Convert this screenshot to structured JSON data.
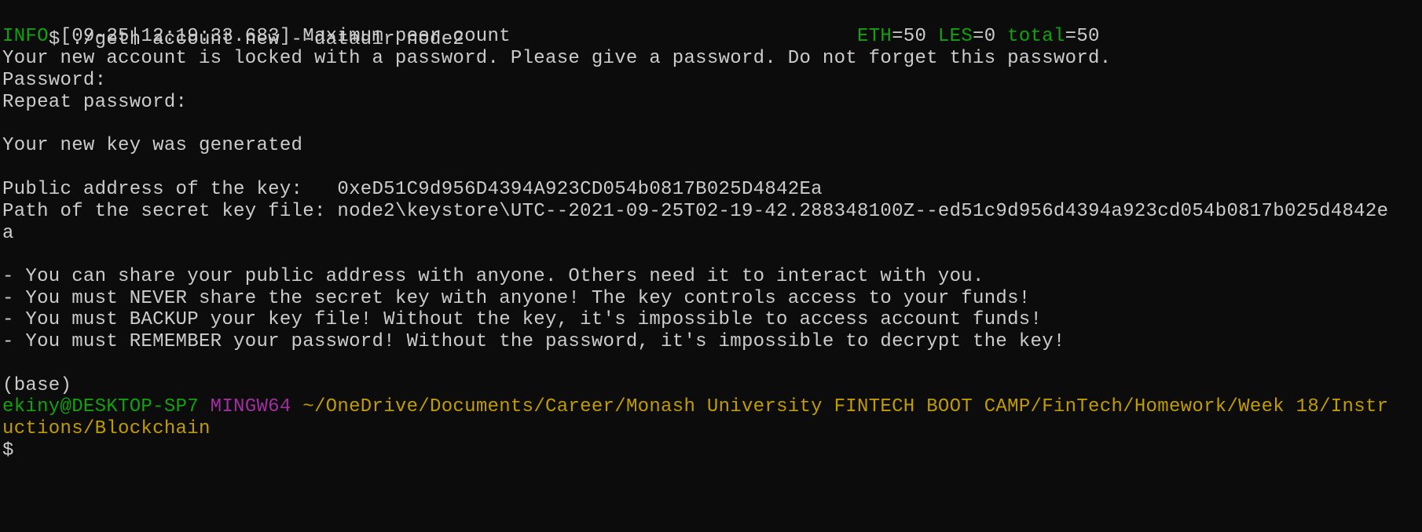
{
  "terminal": {
    "command_line": "$ ./geth account new --datadir node2",
    "info": {
      "level": "INFO",
      "timestamp": "[09-25|12:19:33.683]",
      "message": "Maximum peer count",
      "pad": "                        ",
      "eth_key": "ETH",
      "eth_val": "=50",
      "les_key": "LES",
      "les_val": "=0",
      "total_key": "total",
      "total_val": "=50"
    },
    "locked_msg": "Your new account is locked with a password. Please give a password. Do not forget this password.",
    "password_prompt": "Password:",
    "repeat_prompt": "Repeat password:",
    "generated_msg": "Your new key was generated",
    "public_address_label": "Public address of the key:   ",
    "public_address": "0xeD51C9d956D4394A923CD054b0817B025D4842Ea",
    "secret_path_label": "Path of the secret key file: ",
    "secret_path": "node2\\keystore\\UTC--2021-09-25T02-19-42.288348100Z--ed51c9d956d4394a923cd054b0817b025d4842e",
    "secret_path_wrap": "a",
    "warnings": [
      "- You can share your public address with anyone. Others need it to interact with you.",
      "- You must NEVER share the secret key with anyone! The key controls access to your funds!",
      "- You must BACKUP your key file! Without the key, it's impossible to access account funds!",
      "- You must REMEMBER your password! Without the password, it's impossible to decrypt the key!"
    ],
    "conda_env": "(base)",
    "prompt": {
      "user_host": "ekiny@DESKTOP-SP7",
      "shell": "MINGW64",
      "path": "~/OneDrive/Documents/Career/Monash University FINTECH BOOT CAMP/FinTech/Homework/Week 18/Instr",
      "path_wrap": "uctions/Blockchain"
    },
    "final_prompt": "$"
  },
  "colors": {
    "background": "#0c0c0c",
    "foreground": "#cccccc",
    "green": "#13a10e",
    "magenta": "#a12fa1",
    "yellow": "#c19c00"
  }
}
